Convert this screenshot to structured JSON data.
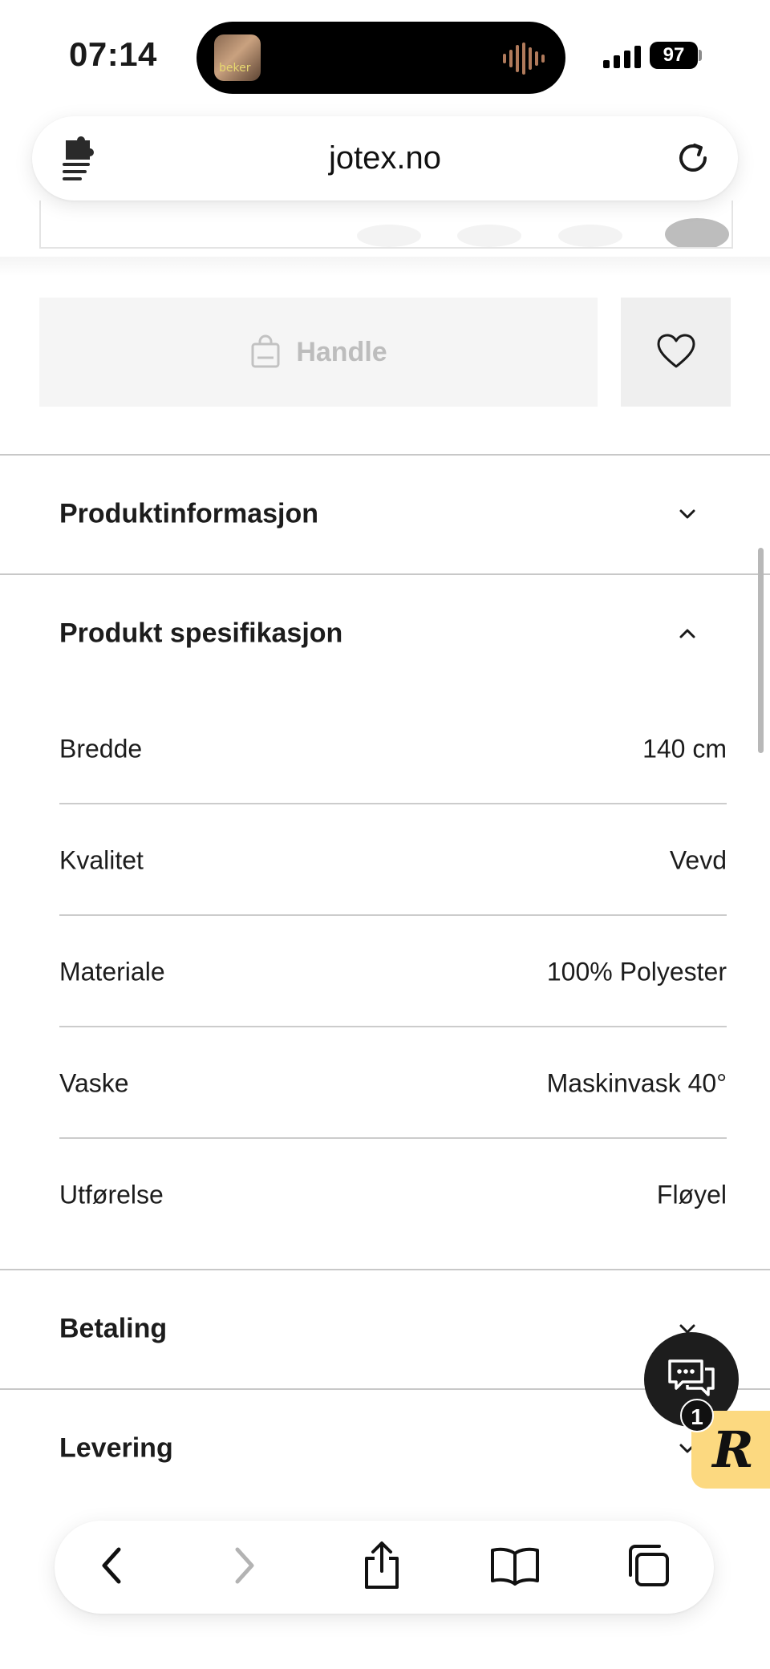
{
  "status_bar": {
    "time": "07:14",
    "battery": "97",
    "now_playing_art_text": "beker"
  },
  "browser": {
    "url": "jotex.no"
  },
  "product_actions": {
    "buy_label": "Handle"
  },
  "accordions": {
    "product_info": "Produktinformasjon",
    "product_spec": "Produkt spesifikasjon",
    "payment": "Betaling",
    "delivery": "Levering"
  },
  "specs": [
    {
      "label": "Bredde",
      "value": "140 cm"
    },
    {
      "label": "Kvalitet",
      "value": "Vevd"
    },
    {
      "label": "Materiale",
      "value": "100% Polyester"
    },
    {
      "label": "Vaske",
      "value": "Maskinvask 40°"
    },
    {
      "label": "Utførelse",
      "value": "Fløyel"
    }
  ],
  "chat": {
    "badge_count": "1",
    "widget_letter": "R"
  },
  "icons": {
    "extension": "puzzle-menu-icon",
    "reload": "reload-icon",
    "bag": "shopping-bag-icon",
    "favorite": "heart-icon",
    "chat": "chat-bubbles-icon",
    "back": "chevron-left-icon",
    "forward": "chevron-right-icon",
    "share": "share-icon",
    "bookmarks": "book-icon",
    "tabs": "tabs-icon"
  },
  "colors": {
    "buy_bg": "#f5f5f5",
    "buy_text": "#bdbdbd",
    "chat_bg": "#1d1d1d",
    "widget_bg": "#fcd980",
    "divider": "#c8c8c8"
  }
}
